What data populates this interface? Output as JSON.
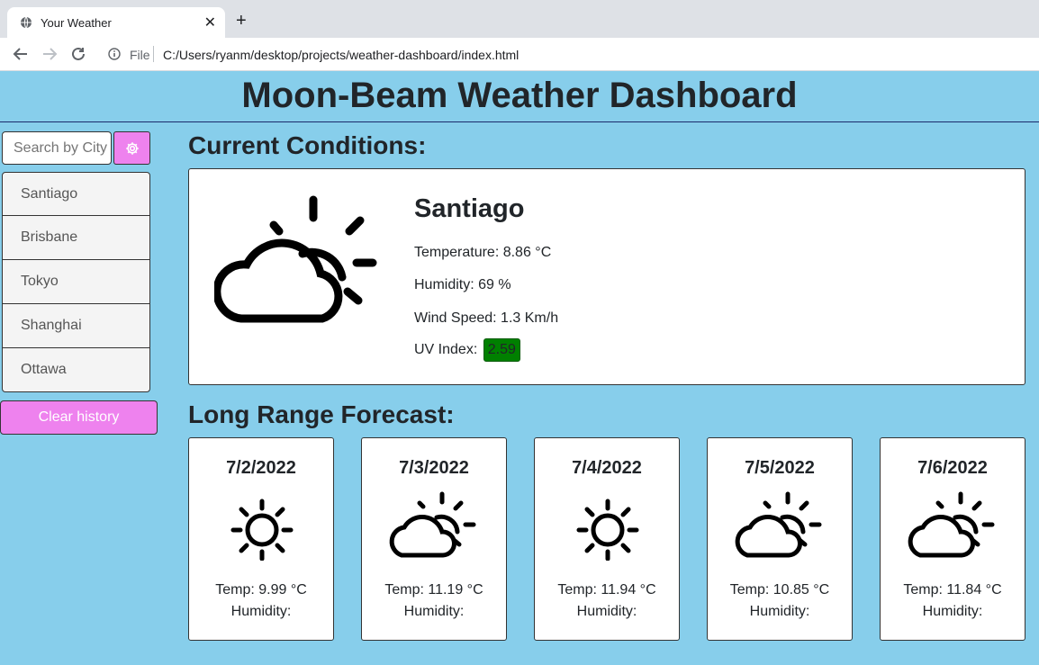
{
  "browser": {
    "tab_title": "Your Weather",
    "new_tab_symbol": "+",
    "close_symbol": "✕",
    "address_scheme": "File",
    "address_url": "C:/Users/ryanm/desktop/projects/weather-dashboard/index.html"
  },
  "header": {
    "title": "Moon-Beam Weather Dashboard"
  },
  "search": {
    "placeholder": "Search by City",
    "button_icon": "gear-icon"
  },
  "history": {
    "items": [
      "Santiago",
      "Brisbane",
      "Tokyo",
      "Shanghai",
      "Ottawa"
    ],
    "clear_label": "Clear history"
  },
  "current": {
    "section_title": "Current Conditions:",
    "city": "Santiago",
    "icon": "partly-cloudy-icon",
    "temperature": "Temperature: 8.86 °C",
    "humidity": "Humidity: 69 %",
    "wind": "Wind Speed: 1.3 Km/h",
    "uv_label": "UV Index:",
    "uv_value": "2.59",
    "uv_color": "#008000"
  },
  "forecast": {
    "section_title": "Long Range Forecast:",
    "days": [
      {
        "date": "7/2/2022",
        "icon": "sun-icon",
        "temp": "Temp: 9.99 °C",
        "humidity": "Humidity:"
      },
      {
        "date": "7/3/2022",
        "icon": "partly-cloudy-icon",
        "temp": "Temp: 11.19 °C",
        "humidity": "Humidity:"
      },
      {
        "date": "7/4/2022",
        "icon": "sun-icon",
        "temp": "Temp: 11.94 °C",
        "humidity": "Humidity:"
      },
      {
        "date": "7/5/2022",
        "icon": "partly-cloudy-icon",
        "temp": "Temp: 10.85 °C",
        "humidity": "Humidity:"
      },
      {
        "date": "7/6/2022",
        "icon": "partly-cloudy-icon",
        "temp": "Temp: 11.84 °C",
        "humidity": "Humidity:"
      }
    ]
  },
  "colors": {
    "page_bg": "#87ceeb",
    "accent": "#ee82ee"
  }
}
